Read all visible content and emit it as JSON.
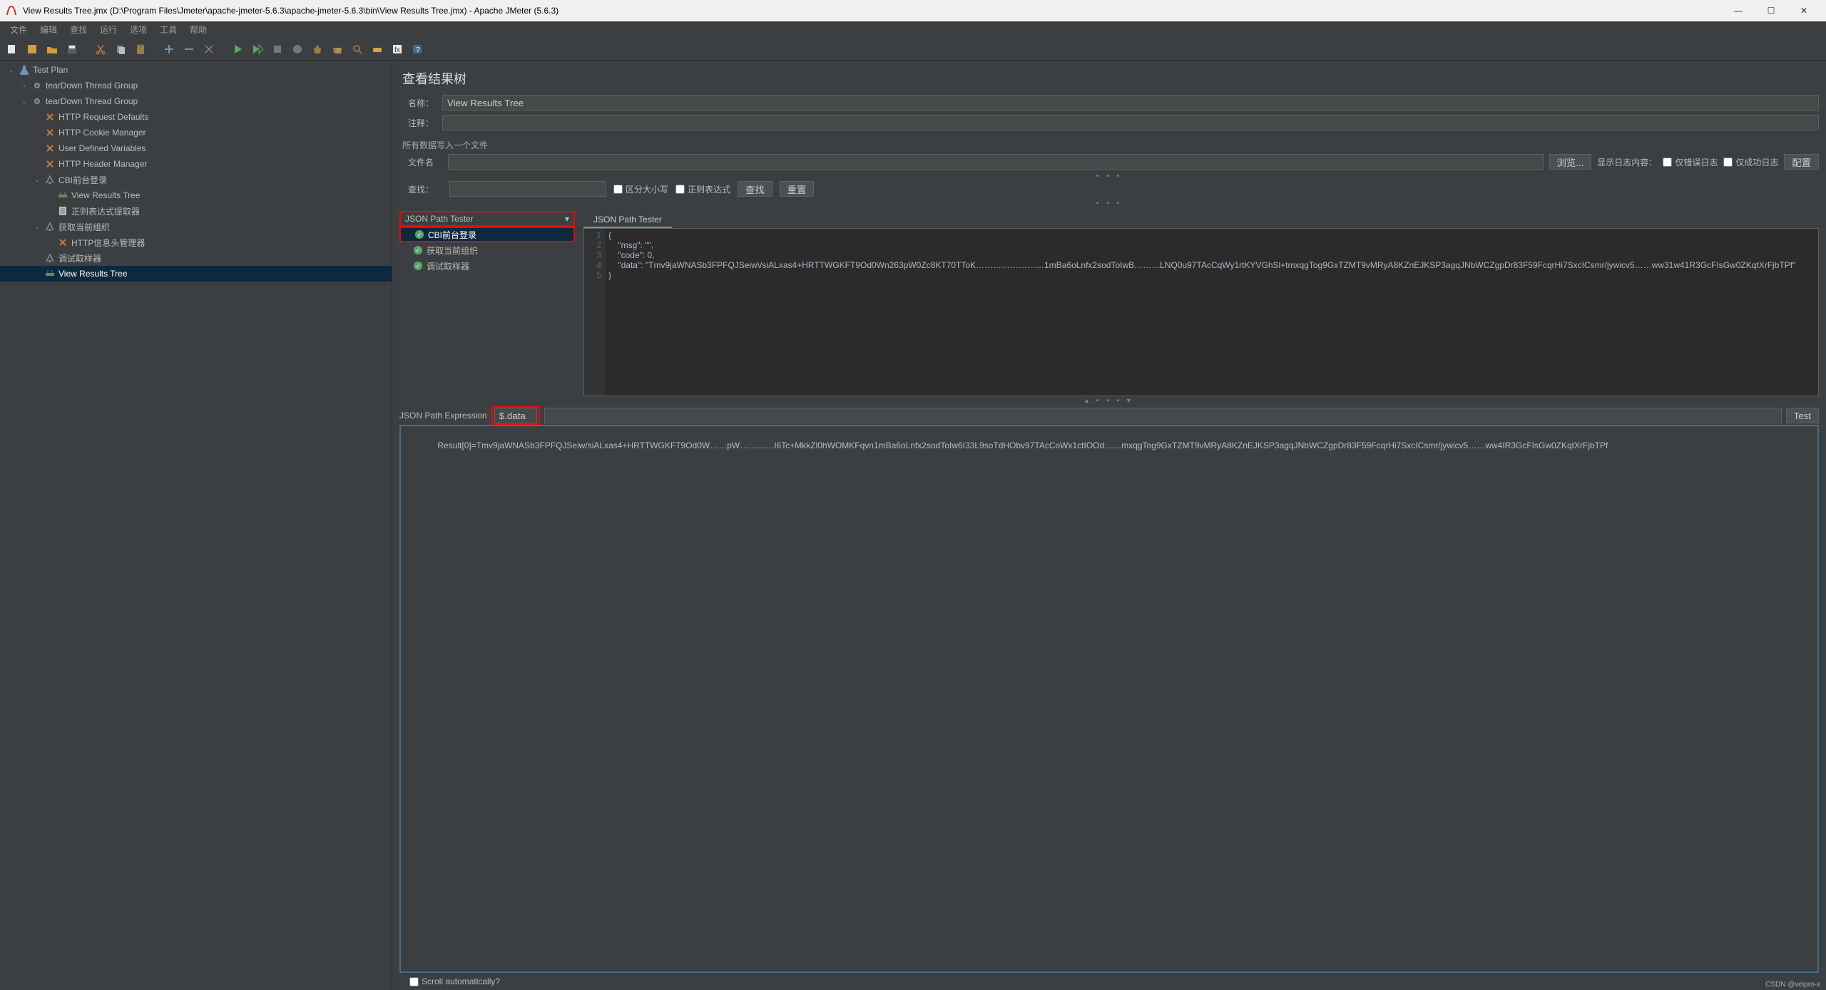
{
  "window": {
    "title": "View Results Tree.jmx (D:\\Program Files\\Jmeter\\apache-jmeter-5.6.3\\apache-jmeter-5.6.3\\bin\\View Results Tree.jmx) - Apache JMeter (5.6.3)"
  },
  "menu": [
    "文件",
    "编辑",
    "查找",
    "运行",
    "选项",
    "工具",
    "帮助"
  ],
  "tree": [
    {
      "label": "Test Plan",
      "depth": 0,
      "expander": "open",
      "icon": "flask"
    },
    {
      "label": "tearDown Thread Group",
      "depth": 1,
      "expander": "closed",
      "icon": "gear"
    },
    {
      "label": "tearDown Thread Group",
      "depth": 1,
      "expander": "open",
      "icon": "gear"
    },
    {
      "label": "HTTP Request Defaults",
      "depth": 2,
      "expander": "none",
      "icon": "x"
    },
    {
      "label": "HTTP Cookie Manager",
      "depth": 2,
      "expander": "none",
      "icon": "x"
    },
    {
      "label": "User Defined Variables",
      "depth": 2,
      "expander": "none",
      "icon": "x"
    },
    {
      "label": "HTTP Header Manager",
      "depth": 2,
      "expander": "none",
      "icon": "x"
    },
    {
      "label": "CBI前台登录",
      "depth": 2,
      "expander": "open",
      "icon": "sampler"
    },
    {
      "label": "View Results Tree",
      "depth": 3,
      "expander": "none",
      "icon": "tree"
    },
    {
      "label": "正则表达式提取器",
      "depth": 3,
      "expander": "none",
      "icon": "doc"
    },
    {
      "label": "获取当前组织",
      "depth": 2,
      "expander": "open",
      "icon": "sampler"
    },
    {
      "label": "HTTP信息头管理器",
      "depth": 3,
      "expander": "none",
      "icon": "x"
    },
    {
      "label": "调试取样器",
      "depth": 2,
      "expander": "none",
      "icon": "sampler"
    },
    {
      "label": "View Results Tree",
      "depth": 2,
      "expander": "none",
      "icon": "tree",
      "selected": true
    }
  ],
  "panel": {
    "title": "查看结果树",
    "labels": {
      "name": "名称：",
      "comment": "注释：",
      "writeAll": "所有数据写入一个文件",
      "filename": "文件名",
      "browse": "浏览...",
      "showLogContent": "显示日志内容：",
      "errorsOnly": "仅错误日志",
      "successOnly": "仅成功日志",
      "configure": "配置",
      "find": "查找：",
      "caseSensitive": "区分大小写",
      "regex": "正则表达式",
      "findBtn": "查找",
      "resetBtn": "重置"
    },
    "nameValue": "View Results Tree"
  },
  "renderer": {
    "selected": "JSON Path Tester",
    "samples": [
      {
        "label": "CBI前台登录",
        "selected": true
      },
      {
        "label": "获取当前组织"
      },
      {
        "label": "调试取样器"
      }
    ]
  },
  "jsonTab": {
    "tabName": "JSON Path Tester",
    "gutter": [
      "1",
      "2",
      "3",
      "4",
      "5"
    ],
    "code": "{\n    \"msg\": \"\",\n    \"code\": 0,\n    \"data\": \"Tmv9jaWNASb3FPFQJSeiw\\/siALxas4+HRTTWGKFT9Od0Wn263pW0Zc8KT70TToK……………………1mBa6oLnfx2sodToIwB………LNQ0u97TAcCqWy1rtKYVGhSl+tmxqgTog9GxTZMT9vMRyA8KZnEJKSP3agqJNbWCZgpDr83F59FcqrHi7SxcICsmr/jywicv5……ww31w41R3GcFIsGw0ZKqtXrFjbTPf\"\n}",
    "exprLabel": "JSON Path Expression",
    "exprValue": "$.data",
    "testBtn": "Test",
    "result": "Result[0]=Tmv9jaWNASb3FPFQJSeiw/siALxas4+HRTTWGKFT9Od0W……pW…………I6Tc+MkkZl0hWOMKFqvn1mBa6oLnfx2sodToIw6I33L9soTdHObv97TAcCoWx1ctIOOd……mxqgTog9GxTZMT9vMRyA8KZnEJKSP3agqJNbWCZgpDr83F59FcqrHi7SxcICsmr/jywicv5……ww4IR3GcFIsGw0ZKqtXrFjbTPf"
  },
  "footer": {
    "scrollAuto": "Scroll automatically?"
  },
  "watermark": "CSDN @veipro-x"
}
